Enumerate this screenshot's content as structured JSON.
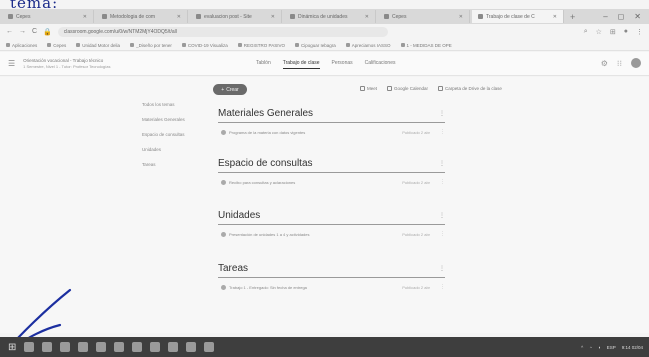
{
  "handwritten_top": "tema:",
  "browser": {
    "tabs": [
      {
        "label": "Cepes",
        "active": false
      },
      {
        "label": "Metodologia de com",
        "active": false
      },
      {
        "label": "evaluacion post - Site",
        "active": false
      },
      {
        "label": "Dinámica de unidades",
        "active": false
      },
      {
        "label": "Cepes",
        "active": false
      },
      {
        "label": "Trabajo de clase de C",
        "active": true
      }
    ],
    "url": "classroom.google.com/u/0/w/NTM2MjY4ODQ5/t/all",
    "bookmarks": [
      "Aplicaciones",
      "Cepes",
      "Unidad Motor delia",
      "_Diseño por tener",
      "COVID-19 Visualiza",
      "REGISTRO PASIVO",
      "Cipoguar Iebagra",
      "Apreciamos IASSO",
      "1 - MEDIDAS DE OPE"
    ]
  },
  "app": {
    "class_title": "Orientación vocacional - Trabajo técnico",
    "class_subtitle": "1 Semestre, Nivel 1 - Tutor: Profesor Tecnologías",
    "tabs": [
      "Tablón",
      "Trabajo de clase",
      "Personas",
      "Calificaciones"
    ],
    "active_tab": "Trabajo de clase",
    "create_label": "Crear",
    "toolbar": [
      "Meet",
      "Google Calendar",
      "Carpeta de Drive de la clase"
    ],
    "topics_nav": [
      "Todos los temas",
      "Materiales Generales",
      "Espacio de consultas",
      "Unidades",
      "Tareas"
    ],
    "topics": [
      {
        "title": "Materiales Generales",
        "item": "Programa de la materia con datos vigentes",
        "date": "Publicado 2 abr"
      },
      {
        "title": "Espacio de consultas",
        "item": "Recibo para consultas y aclaraciones",
        "date": "Publicado 2 abr"
      },
      {
        "title": "Unidades",
        "item": "Presentación de unidades 1 a 4 y actividades",
        "date": "Publicado 2 abr"
      },
      {
        "title": "Tareas",
        "item": "Trabajo 1 - Entregado: Sin fecha de entrega",
        "date": "Publicado 2 abr"
      }
    ]
  },
  "taskbar": {
    "tray_time": "9:14",
    "tray_lang": "ESP",
    "tray_date": "02/04"
  }
}
